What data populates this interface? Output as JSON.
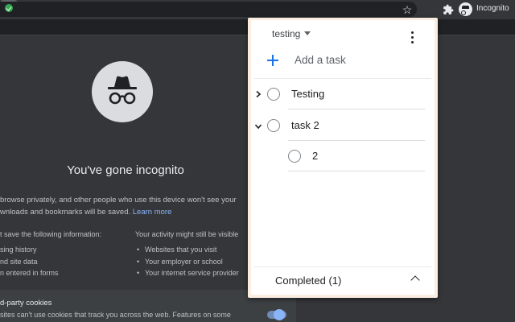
{
  "browser": {
    "profile_label": "Incognito",
    "icons": [
      "star-icon",
      "extension-check-icon",
      "puzzle-icon",
      "incognito-avatar-icon"
    ]
  },
  "incognito_page": {
    "title": "You've gone incognito",
    "desc_line1": "browse privately, and other people who use this device won't see your",
    "desc_line2": "wnloads and bookmarks will be saved.",
    "learn_more": "Learn more",
    "left_heading": "t save the following information:",
    "left_items": [
      "sing history",
      "nd site data",
      "n entered in forms"
    ],
    "right_heading": "Your activity might still be visible",
    "right_items": [
      "Websites that you visit",
      "Your employer or school",
      "Your internet service provider"
    ],
    "cookies_title": "d-party cookies",
    "cookies_desc": "sites can't use cookies that track you across the web. Features on some"
  },
  "popup": {
    "list_name": "testing",
    "add_task": "Add a task",
    "tasks": [
      {
        "title": "Testing",
        "chevron": "›"
      },
      {
        "title": "task 2",
        "chevron": "⌄"
      },
      {
        "title": "2"
      }
    ],
    "completed_label": "Completed (1)",
    "colors": {
      "accent": "#1a73e8",
      "frame": "#fbeee0"
    }
  }
}
